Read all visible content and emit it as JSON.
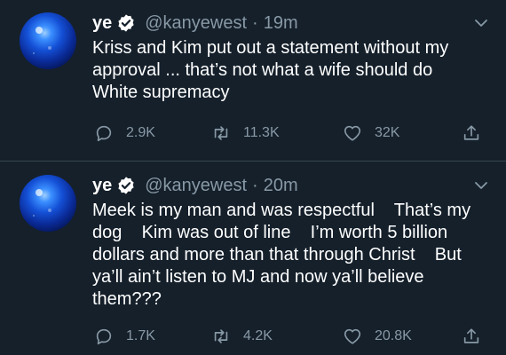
{
  "tweets": [
    {
      "name": "ye",
      "handle": "@kanyewest",
      "separator": "·",
      "time": "19m",
      "text": "Kriss and Kim put out a statement without my approval ... that’s not what a wife should do\nWhite supremacy",
      "replies": "2.9K",
      "retweets": "11.3K",
      "likes": "32K"
    },
    {
      "name": "ye",
      "handle": "@kanyewest",
      "separator": "·",
      "time": "20m",
      "text": "Meek is my man and was respectful    That’s my dog    Kim was out of line    I’m worth 5 billion dollars and more than that through Christ    But ya’ll ain’t listen to MJ and now ya’ll believe them???",
      "replies": "1.7K",
      "retweets": "4.2K",
      "likes": "20.8K"
    }
  ],
  "icons": {
    "verified": "verified-badge-icon",
    "menu": "chevron-down-icon",
    "reply": "reply-icon",
    "retweet": "retweet-icon",
    "like": "heart-icon",
    "share": "share-icon"
  },
  "colors": {
    "background": "#15202b",
    "text": "#ffffff",
    "secondary": "#8899a6",
    "divider": "#38444d",
    "verified_badge": "#ffffff"
  }
}
